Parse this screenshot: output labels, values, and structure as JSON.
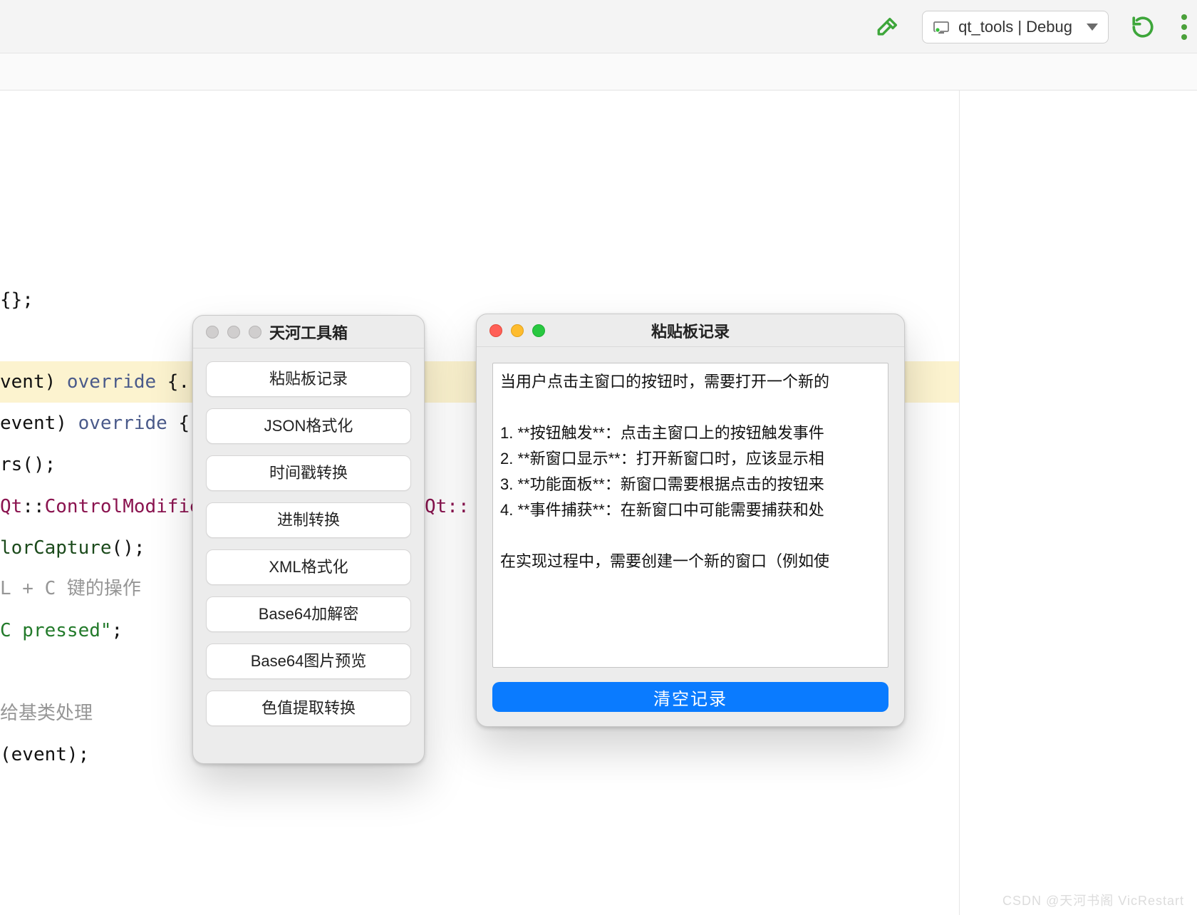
{
  "toolbar": {
    "target_label": "qt_tools | Debug"
  },
  "editor": {
    "lines": [
      {
        "pre": "",
        "body": "{};",
        "cls": ""
      },
      {
        "pre": "",
        "body": "",
        "cls": ""
      },
      {
        "pre": "",
        "body": "vent) override {..",
        "cls": "hl",
        "segments": [
          [
            "vent) ",
            "p"
          ],
          [
            "override",
            "ov"
          ],
          [
            " {..",
            "p"
          ]
        ]
      },
      {
        "pre": "",
        "body": "event) override {",
        "segments": [
          [
            "event) ",
            "p"
          ],
          [
            "override",
            "ov"
          ],
          [
            " {",
            "p"
          ]
        ]
      },
      {
        "pre": "",
        "body": "rs();",
        "cls": ""
      },
      {
        "pre": "",
        "body": "Qt::ControlModifie",
        "segments": [
          [
            "Qt",
            "ql"
          ],
          [
            "::",
            "p"
          ],
          [
            "ControlModifie",
            "ql2"
          ]
        ]
      },
      {
        "pre": "",
        "body": "lorCapture();",
        "segments": [
          [
            "lorCapture",
            "fn"
          ],
          [
            "();",
            "p"
          ]
        ]
      },
      {
        "pre": "",
        "body": "L + C 键的操作",
        "cls": "cmt"
      },
      {
        "pre": "",
        "body": "C pressed\";",
        "segments": [
          [
            "C pressed\"",
            "str"
          ],
          [
            ";",
            "p"
          ]
        ]
      },
      {
        "pre": "",
        "body": "",
        "cls": ""
      },
      {
        "pre": "",
        "body": "给基类处理",
        "cls": "cmt"
      },
      {
        "pre": "",
        "body": "(event);",
        "cls": ""
      }
    ],
    "frag_qt": "Qt::"
  },
  "toolbox": {
    "title": "天河工具箱",
    "buttons": [
      "粘贴板记录",
      "JSON格式化",
      "时间戳转换",
      "进制转换",
      "XML格式化",
      "Base64加解密",
      "Base64图片预览",
      "色值提取转换"
    ]
  },
  "clipwin": {
    "title": "粘贴板记录",
    "textarea": "当用户点击主窗口的按钮时，需要打开一个新的\n\n1. **按钮触发**：点击主窗口上的按钮触发事件\n2. **新窗口显示**：打开新窗口时，应该显示相\n3. **功能面板**：新窗口需要根据点击的按钮来\n4. **事件捕获**：在新窗口中可能需要捕获和处\n\n在实现过程中，需要创建一个新的窗口（例如使",
    "clear_label": "清空记录"
  },
  "watermark": "CSDN @天河书阁 VicRestart"
}
